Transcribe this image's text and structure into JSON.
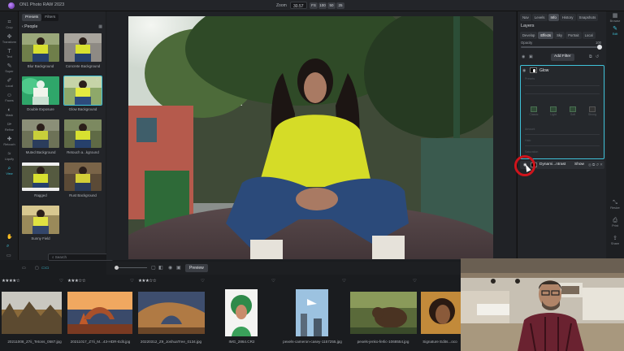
{
  "app": {
    "title": "ON1 Photo RAW 2023"
  },
  "zoom": {
    "label": "Zoom",
    "value": "30.57",
    "chips": [
      "FS",
      "100",
      "50",
      "25"
    ]
  },
  "tools": [
    {
      "name": "tool-crop",
      "label": "Crop",
      "glyph": "⌗"
    },
    {
      "name": "tool-transform",
      "label": "Transform",
      "glyph": "✥"
    },
    {
      "name": "tool-text",
      "label": "Text",
      "glyph": "T"
    },
    {
      "name": "tool-super",
      "label": "Super",
      "glyph": "✎"
    },
    {
      "name": "tool-local",
      "label": "Local",
      "glyph": "✐"
    },
    {
      "name": "tool-faces",
      "label": "Faces",
      "glyph": "☺"
    },
    {
      "name": "tool-mask",
      "label": "Mask",
      "glyph": "◐"
    },
    {
      "name": "tool-refine",
      "label": "Refine",
      "glyph": "✑"
    },
    {
      "name": "tool-retouch",
      "label": "Retouch",
      "glyph": "✚"
    },
    {
      "name": "tool-liquify",
      "label": "Liquify",
      "glyph": "≈"
    },
    {
      "name": "tool-view",
      "label": "View",
      "glyph": "⌕"
    }
  ],
  "presets": {
    "tabs": [
      "Presets",
      "Filters"
    ],
    "category": "People",
    "items": [
      {
        "label": "Blur Background"
      },
      {
        "label": "Concrete Background"
      },
      {
        "label": "Double Exposure"
      },
      {
        "label": "Glow Background"
      },
      {
        "label": "Muted Background"
      },
      {
        "label": "Retouch a...kground"
      },
      {
        "label": "Ragged"
      },
      {
        "label": "Rust Background"
      },
      {
        "label": "Sunny Field"
      }
    ],
    "search_placeholder": "Search"
  },
  "right_panel": {
    "top_tabs": [
      "Nav",
      "Levels",
      "Info",
      "History",
      "Snapshots"
    ],
    "layers_title": "Layers",
    "mode_tabs": [
      "Develop",
      "Effects",
      "Sky",
      "Portrait",
      "Local"
    ],
    "opacity_label": "Opacity",
    "opacity_value": "100",
    "add_filter": "Add Filter",
    "glow": {
      "title": "Glow",
      "dim_labels": [
        "Presets",
        "Amount",
        "Halo",
        "Saturation"
      ],
      "modes": [
        "Classic",
        "Light",
        "Soft",
        "Strong"
      ]
    },
    "dynamic_row": {
      "label": "Dynami...ntrast",
      "show": "Show"
    }
  },
  "modules": [
    {
      "name": "module-browse",
      "label": "Browse",
      "glyph": "▦"
    },
    {
      "name": "module-edit",
      "label": "Edit",
      "glyph": "✎"
    },
    {
      "name": "module-resize",
      "label": "Resize",
      "glyph": "⤡"
    },
    {
      "name": "module-print",
      "label": "Print",
      "glyph": "⎙"
    },
    {
      "name": "module-share",
      "label": "Share",
      "glyph": "⇪"
    }
  ],
  "strip_toolbar": {
    "preview": "Preview"
  },
  "filmstrip": [
    {
      "name": "20211008_Z7ii_Tetons_0587.jpg",
      "stars": "★★★★☆"
    },
    {
      "name": "20211017_Z7ii_M...43-HDR-Edit.jpg",
      "stars": "★★★☆☆"
    },
    {
      "name": "20220312_Z9_JoshuaTree_0134.jpg",
      "stars": "★★★☆☆"
    },
    {
      "name": "IMG_2864.CR2",
      "stars": ""
    },
    {
      "name": "pexels-cameron-casey-1157255.jpg",
      "stars": ""
    },
    {
      "name": "pexels-jenko-ferlic-1068554.jpg",
      "stars": ""
    },
    {
      "name": "Signature Edits...oco",
      "stars": ""
    }
  ],
  "colors": {
    "accent": "#3fc1d8",
    "highlight_ring": "#d0141c",
    "panel": "#222428"
  }
}
